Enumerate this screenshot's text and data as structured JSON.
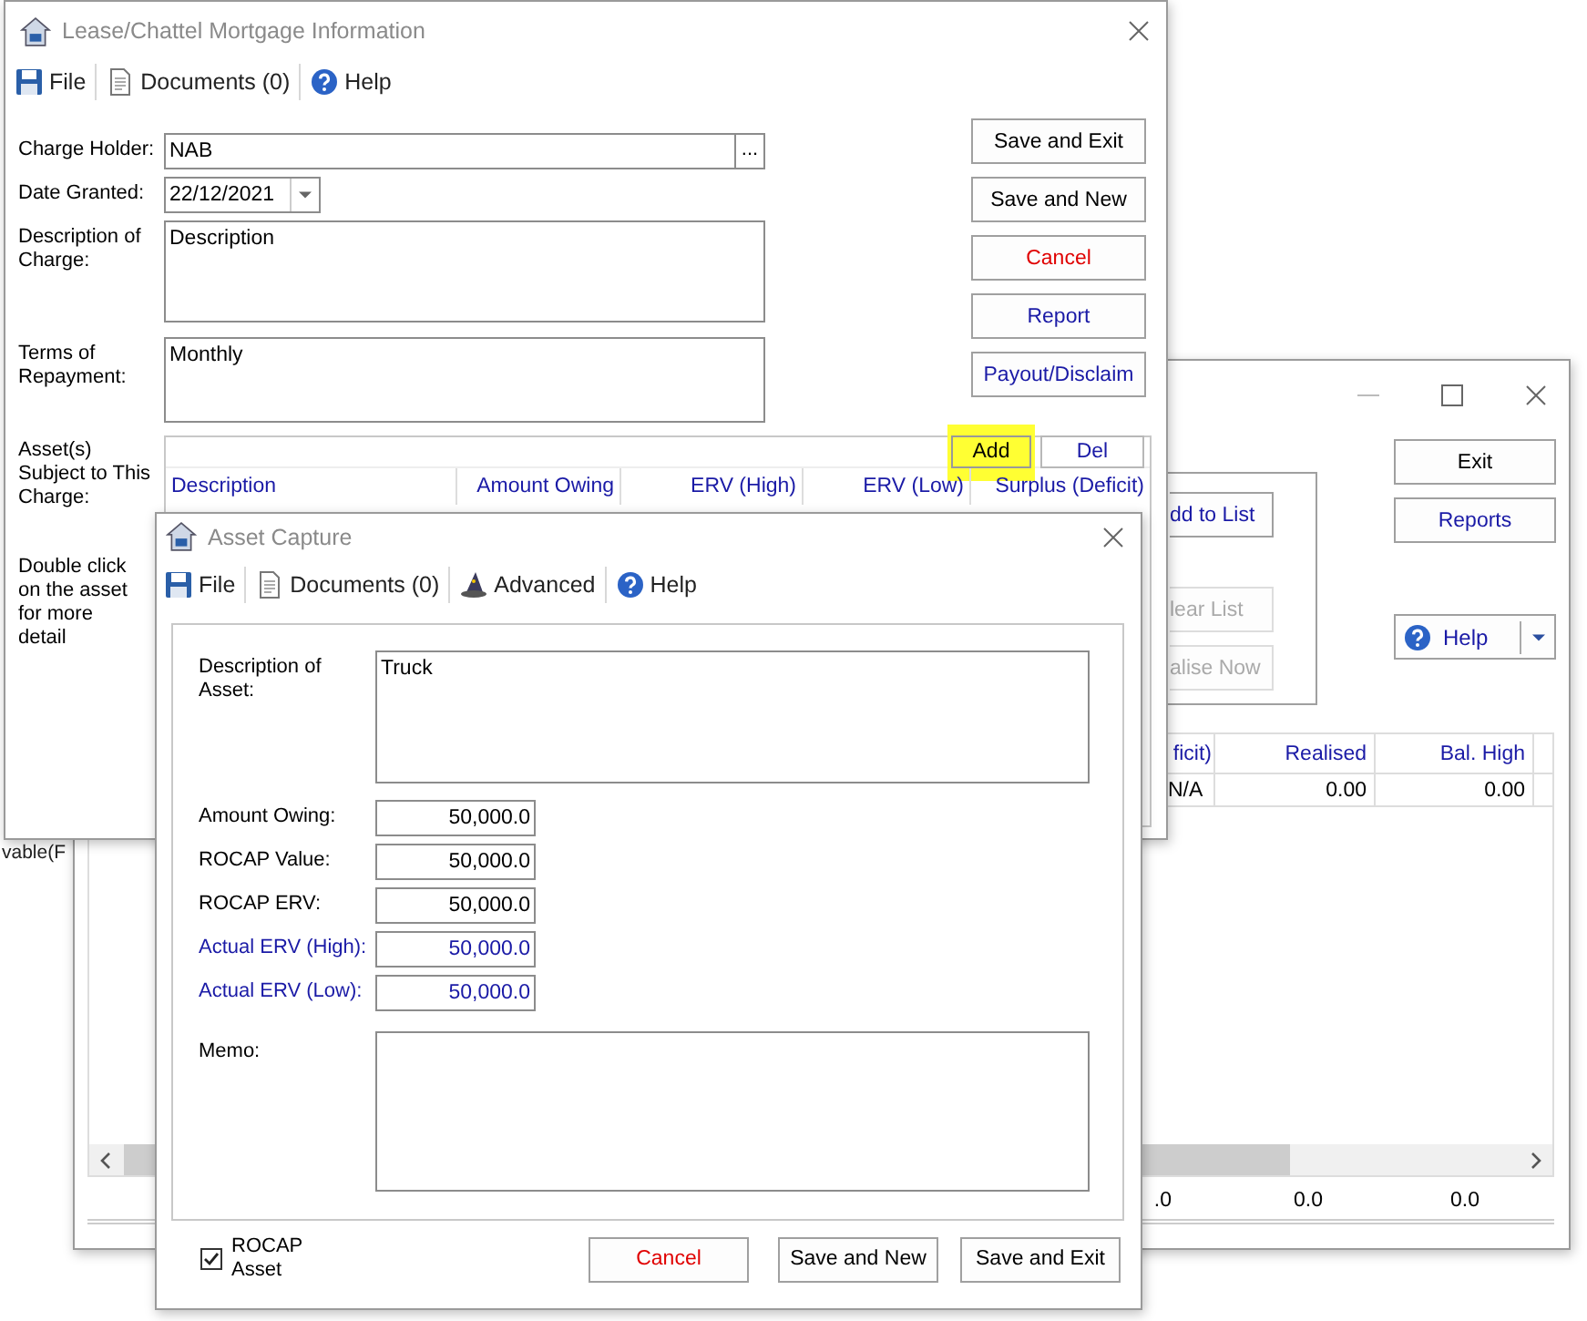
{
  "background_text": "vable(F",
  "back_window": {
    "panel_buttons": [
      {
        "label": "dd to List",
        "disabled": false
      },
      {
        "label": "lear List",
        "disabled": true
      },
      {
        "label": "alise Now",
        "disabled": true
      }
    ],
    "buttons": [
      {
        "label": "Exit",
        "kind": "normal"
      },
      {
        "label": "Reports",
        "kind": "link"
      }
    ],
    "help_button": "Help",
    "table": {
      "columns": [
        "ficit)",
        "Realised",
        "Bal. High"
      ],
      "rows": [
        [
          "N/A",
          "0.00",
          "0.00"
        ]
      ]
    },
    "totals": [
      ".0",
      "0.0",
      "0.0"
    ]
  },
  "main_window": {
    "title": "Lease/Chattel Mortgage Information",
    "menu": [
      {
        "label": "File",
        "kind": "save"
      },
      {
        "label": "Documents (0)",
        "kind": "document"
      },
      {
        "label": "Help",
        "kind": "help"
      }
    ],
    "charge_holder": {
      "label": "Charge Holder:",
      "value": "NAB",
      "lookup": "..."
    },
    "date_granted": {
      "label": "Date Granted:",
      "value": "22/12/2021"
    },
    "description": {
      "label": "Description of Charge:",
      "value": "Description"
    },
    "terms": {
      "label": "Terms of Repayment:",
      "value": "Monthly"
    },
    "buttons": [
      {
        "label": "Save and Exit",
        "kind": "normal"
      },
      {
        "label": "Save and New",
        "kind": "normal"
      },
      {
        "label": "Cancel",
        "kind": "cancel"
      },
      {
        "label": "Report",
        "kind": "link"
      },
      {
        "label": "Payout/Disclaim",
        "kind": "link"
      }
    ],
    "assets": {
      "label": "Asset(s) Subject to This Charge:",
      "add": {
        "label": "Add",
        "highlighted": true
      },
      "del": "Del",
      "columns": [
        "Description",
        "Amount Owing",
        "ERV (High)",
        "ERV (Low)",
        "Surplus (Deficit)"
      ]
    },
    "hint": "Double click on the asset for more detail"
  },
  "asset_window": {
    "title": "Asset Capture",
    "menu": [
      {
        "label": "File",
        "kind": "save"
      },
      {
        "label": "Documents (0)",
        "kind": "document"
      },
      {
        "label": "Advanced",
        "kind": "wizard"
      },
      {
        "label": "Help",
        "kind": "help"
      }
    ],
    "description": {
      "label": "Description of Asset:",
      "value": "Truck"
    },
    "fields": [
      {
        "label": "Amount Owing:",
        "value": "50,000.0",
        "kind": "plain"
      },
      {
        "label": "ROCAP Value:",
        "value": "50,000.0",
        "kind": "plain"
      },
      {
        "label": "ROCAP ERV:",
        "value": "50,000.0",
        "kind": "plain"
      },
      {
        "label": "Actual ERV (High):",
        "value": "50,000.0",
        "kind": "linked"
      },
      {
        "label": "Actual ERV (Low):",
        "value": "50,000.0",
        "kind": "linked"
      }
    ],
    "memo": {
      "label": "Memo:"
    },
    "rocap_asset": {
      "label": "ROCAP Asset",
      "checked": true
    },
    "buttons": [
      {
        "label": "Cancel",
        "kind": "cancel"
      },
      {
        "label": "Save and New",
        "kind": "normal"
      },
      {
        "label": "Save and Exit",
        "kind": "normal"
      }
    ]
  }
}
